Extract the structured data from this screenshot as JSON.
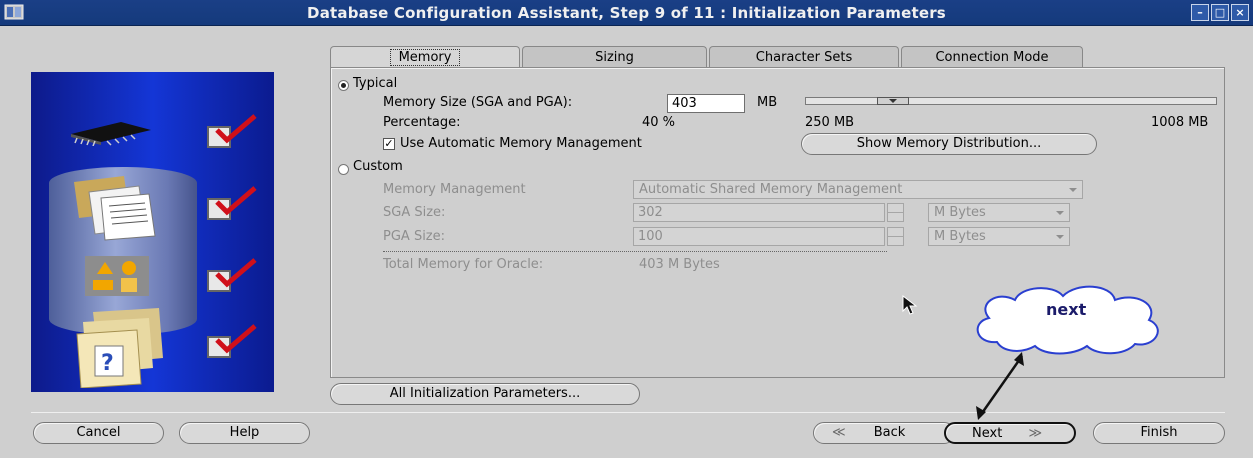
{
  "window": {
    "title": "Database Configuration Assistant, Step 9 of 11 : Initialization Parameters",
    "buttons": [
      "–",
      "□",
      "×"
    ]
  },
  "tabs": [
    {
      "label": "Memory",
      "active": true
    },
    {
      "label": "Sizing",
      "active": false
    },
    {
      "label": "Character Sets",
      "active": false
    },
    {
      "label": "Connection Mode",
      "active": false
    }
  ],
  "memory": {
    "typical_label": "Typical",
    "typical_selected": true,
    "memory_size_label": "Memory Size (SGA and PGA):",
    "memory_size_value": "403",
    "memory_size_unit": "MB",
    "percentage_label": "Percentage:",
    "percentage_value": "40 %",
    "slider_min_label": "250 MB",
    "slider_max_label": "1008 MB",
    "slider_level_mb": 403,
    "amm_label": "Use Automatic Memory Management",
    "amm_checked": true,
    "show_distribution_button": "Show Memory Distribution...",
    "custom_label": "Custom",
    "custom_selected": false,
    "memory_management_label": "Memory Management",
    "memory_management_value": "Automatic Shared Memory Management",
    "sga_label": "SGA Size:",
    "sga_value": "302",
    "sga_unit": "M Bytes",
    "pga_label": "PGA Size:",
    "pga_value": "100",
    "pga_unit": "M Bytes",
    "total_label": "Total Memory for Oracle:",
    "total_value": "403 M Bytes"
  },
  "all_params_button": "All Initialization Parameters...",
  "footer": {
    "cancel": "Cancel",
    "help": "Help",
    "back": "Back",
    "back_glyph": "≪",
    "next": "Next",
    "next_glyph": "≫",
    "finish": "Finish"
  },
  "annotation": {
    "cloud_text": "next"
  },
  "colors": {
    "titlebar": "#1a3f86",
    "window_bg": "#cfcfcf",
    "side_panel": "#1436d6",
    "check_red": "#d0101a"
  },
  "icons": [
    "database-assistant-icon",
    "chip-icon",
    "documents-icon",
    "shapes-icon",
    "help-folder-icon",
    "red-checkmark-icon",
    "mouse-cursor-icon"
  ]
}
